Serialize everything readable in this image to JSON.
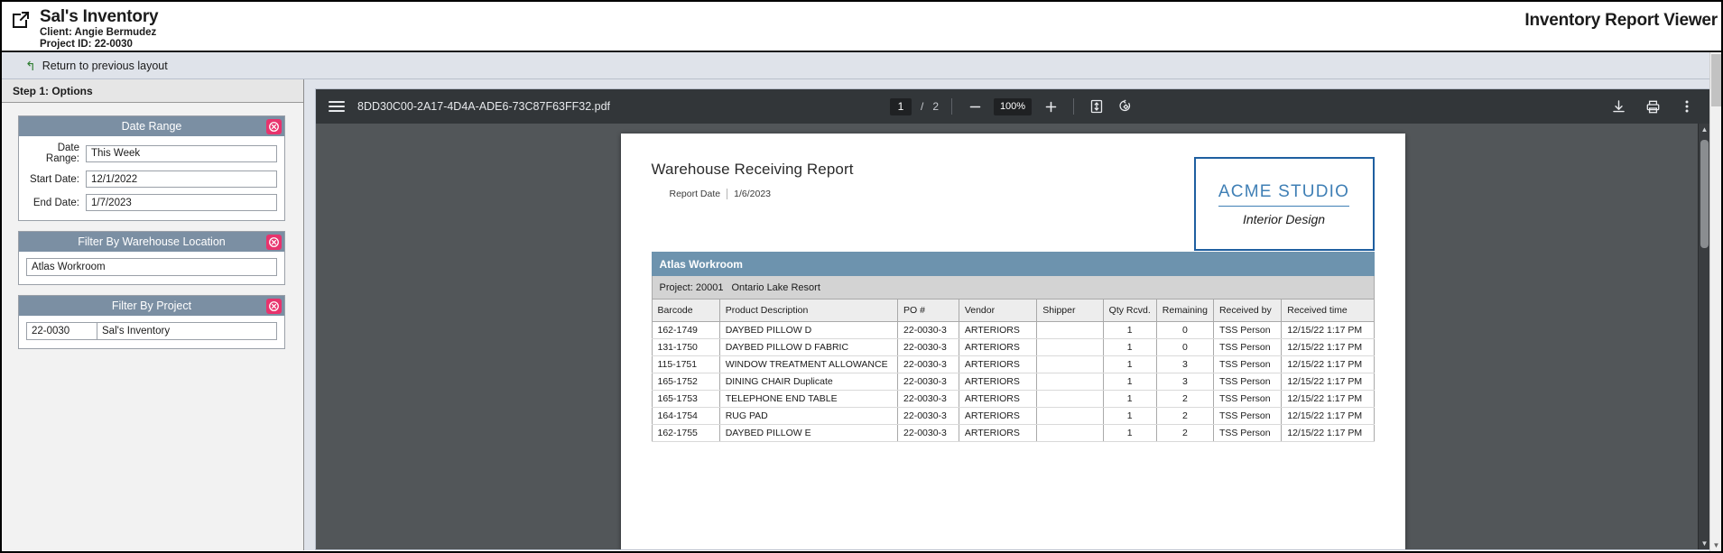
{
  "header": {
    "external_link_icon": "external-link-icon",
    "app_title": "Sal's Inventory",
    "client_line": "Client: Angie Bermudez",
    "project_line": "Project ID: 22-0030",
    "viewer_title": "Inventory Report Viewer"
  },
  "return_bar": {
    "arrow_icon": "back-arrow-icon",
    "label": "Return to previous layout"
  },
  "options_panel": {
    "step_header": "Step 1: Options",
    "cards": [
      {
        "title": "Date Range",
        "close_icon": "remove-circle-icon",
        "fields": [
          {
            "label": "Date Range:",
            "value": "This Week"
          },
          {
            "label": "Start Date:",
            "value": "12/1/2022"
          },
          {
            "label": "End Date:",
            "value": "1/7/2023"
          }
        ]
      },
      {
        "title": "Filter By Warehouse Location",
        "close_icon": "remove-circle-icon",
        "value": "Atlas Workroom"
      },
      {
        "title": "Filter By Project",
        "close_icon": "remove-circle-icon",
        "code": "22-0030",
        "name": "Sal's Inventory"
      }
    ]
  },
  "pdf_toolbar": {
    "menu_icon": "hamburger-menu-icon",
    "file_name": "8DD30C00-2A17-4D4A-ADE6-73C87F63FF32.pdf",
    "current_page": "1",
    "page_separator": "/",
    "total_pages": "2",
    "zoom_out_icon": "minus-icon",
    "zoom_level": "100%",
    "zoom_in_icon": "plus-icon",
    "fit_page_icon": "fit-to-page-icon",
    "rotate_icon": "rotate-icon",
    "download_icon": "download-icon",
    "print_icon": "print-icon",
    "more_icon": "more-vertical-icon"
  },
  "document": {
    "title": "Warehouse Receiving Report",
    "report_date_label": "Report Date",
    "report_date_value": "1/6/2023",
    "logo": {
      "main": "ACME STUDIO",
      "sub": "Interior Design"
    },
    "section_title": "Atlas Workroom",
    "project_label": "Project: 20001",
    "project_name": "Ontario Lake Resort",
    "table": {
      "columns": [
        "Barcode",
        "Product Description",
        "PO #",
        "Vendor",
        "Shipper",
        "Qty Rcvd.",
        "Remaining",
        "Received by",
        "Received time"
      ],
      "rows": [
        [
          "162-1749",
          "DAYBED PILLOW D",
          "22-0030-3",
          "ARTERIORS",
          "",
          "1",
          "0",
          "TSS Person",
          "12/15/22 1:17 PM"
        ],
        [
          "131-1750",
          "DAYBED PILLOW D FABRIC",
          "22-0030-3",
          "ARTERIORS",
          "",
          "1",
          "0",
          "TSS Person",
          "12/15/22 1:17 PM"
        ],
        [
          "115-1751",
          "WINDOW TREATMENT ALLOWANCE",
          "22-0030-3",
          "ARTERIORS",
          "",
          "1",
          "3",
          "TSS Person",
          "12/15/22 1:17 PM"
        ],
        [
          "165-1752",
          "DINING CHAIR Duplicate",
          "22-0030-3",
          "ARTERIORS",
          "",
          "1",
          "3",
          "TSS Person",
          "12/15/22 1:17 PM"
        ],
        [
          "165-1753",
          "TELEPHONE END TABLE",
          "22-0030-3",
          "ARTERIORS",
          "",
          "1",
          "2",
          "TSS Person",
          "12/15/22 1:17 PM"
        ],
        [
          "164-1754",
          "RUG PAD",
          "22-0030-3",
          "ARTERIORS",
          "",
          "1",
          "2",
          "TSS Person",
          "12/15/22 1:17 PM"
        ],
        [
          "162-1755",
          "DAYBED PILLOW E",
          "22-0030-3",
          "ARTERIORS",
          "",
          "1",
          "2",
          "TSS Person",
          "12/15/22 1:17 PM"
        ]
      ]
    }
  }
}
